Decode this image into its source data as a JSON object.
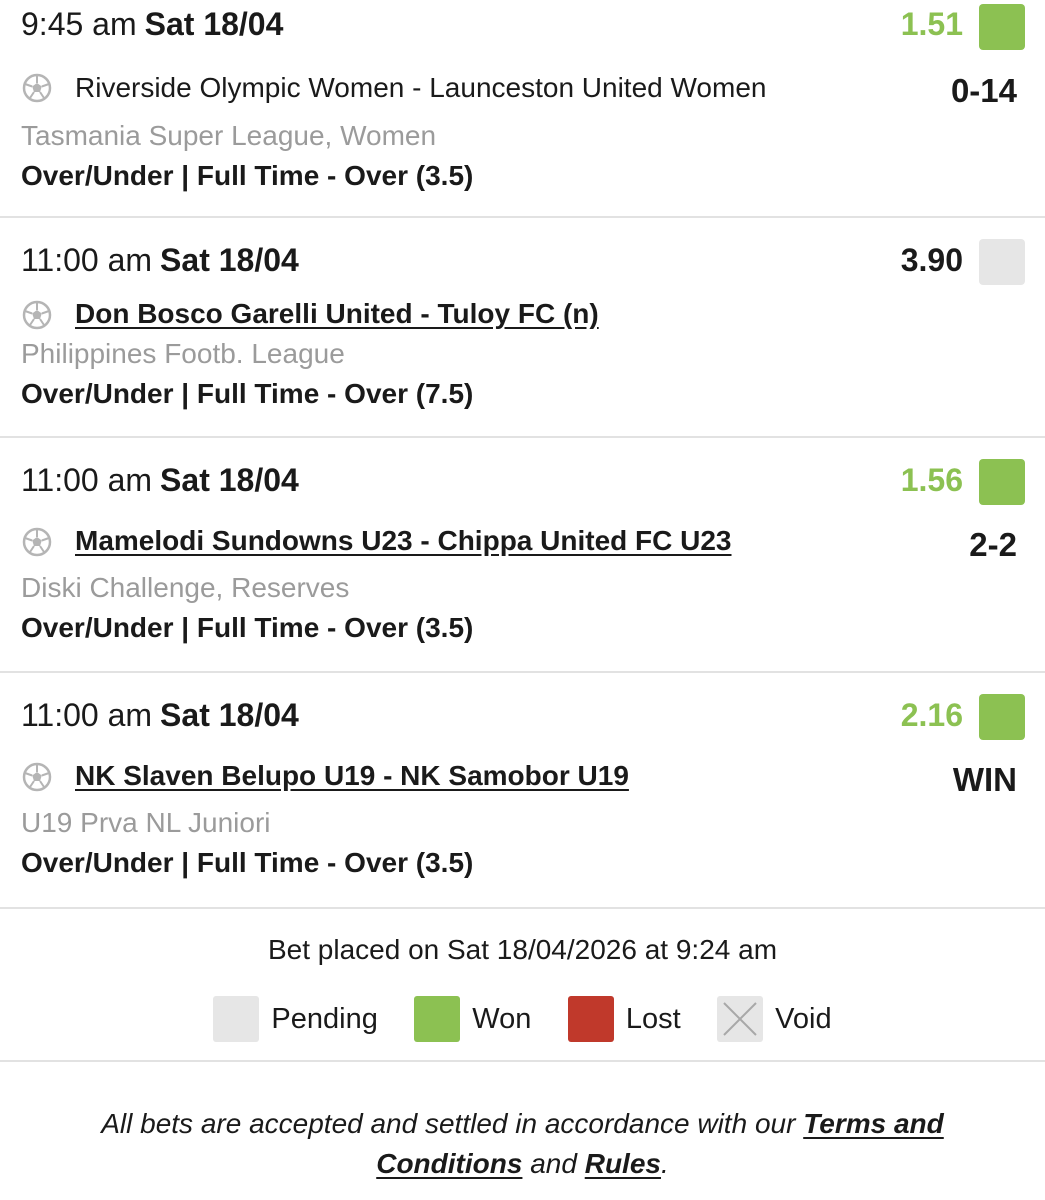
{
  "bets": [
    {
      "time": "9:45 am",
      "day": "Sat 18/04",
      "odds": "1.51",
      "status": "won",
      "match": "Riverside Olympic Women - Launceston United Women",
      "score": "0-14",
      "league": "Tasmania Super League, Women",
      "market": "Over/Under | Full Time - Over (3.5)"
    },
    {
      "time": "11:00 am",
      "day": "Sat 18/04",
      "odds": "3.90",
      "status": "pending",
      "match": "Don Bosco Garelli United - Tuloy FC (n)",
      "score": "",
      "league": "Philippines Footb. League",
      "market": "Over/Under | Full Time - Over (7.5)"
    },
    {
      "time": "11:00 am",
      "day": "Sat 18/04",
      "odds": "1.56",
      "status": "won",
      "match": "Mamelodi Sundowns U23 - Chippa United FC U23",
      "score": "2-2",
      "league": "Diski Challenge, Reserves",
      "market": "Over/Under | Full Time - Over (3.5)"
    },
    {
      "time": "11:00 am",
      "day": "Sat 18/04",
      "odds": "2.16",
      "status": "won",
      "match": "NK Slaven Belupo U19 - NK Samobor U19",
      "score": "WIN",
      "league": "U19 Prva NL Juniori",
      "market": "Over/Under | Full Time - Over (3.5)"
    }
  ],
  "footer": {
    "placed": "Bet placed on Sat 18/04/2026 at 9:24 am",
    "legend": {
      "pending": "Pending",
      "won": "Won",
      "lost": "Lost",
      "void": "Void"
    },
    "terms_prefix": "All bets are accepted and settled in accordance with our",
    "terms_link": "Terms and Conditions",
    "terms_mid": "and",
    "rules_link": "Rules",
    "terms_suffix": "."
  },
  "colors": {
    "won": "#8cc152",
    "pending": "#e6e6e6",
    "lost": "#c0392b",
    "void": "#e6e6e6"
  },
  "icons": {
    "sport": "soccer-ball-icon",
    "void": "cross-icon"
  }
}
